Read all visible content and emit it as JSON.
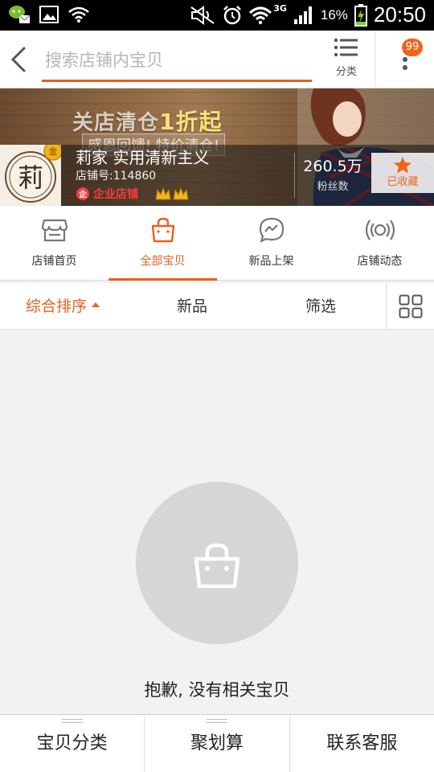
{
  "status_bar": {
    "battery": "16%",
    "network": "3G",
    "time": "20:50",
    "icons": [
      "wechat-notification-icon",
      "image-notification-icon",
      "wifi-alt-icon",
      "mute-icon",
      "alarm-icon",
      "wifi-icon",
      "signal-icon",
      "battery-charging-icon"
    ]
  },
  "header": {
    "search_placeholder": "搜索店铺内宝贝",
    "category_label": "分类",
    "badge_count": "99"
  },
  "banner": {
    "promo_pre": "关店清仓",
    "promo_hl": "1折起",
    "promo_post": "",
    "sub_text": "感恩回馈! 特价清仓!"
  },
  "shop": {
    "logo_char": "莉",
    "logo_badge": "金",
    "name": "莉家 实用清新主义",
    "id_text": "店铺号:114860",
    "type_label": "企业店铺",
    "fans_count": "260.5万",
    "fans_label": "粉丝数",
    "favorite_label": "已收藏"
  },
  "tabs": [
    {
      "label": "店铺首页",
      "icon": "store-icon",
      "active": false
    },
    {
      "label": "全部宝贝",
      "icon": "bag-icon",
      "active": true
    },
    {
      "label": "新品上架",
      "icon": "new-arrival-icon",
      "active": false
    },
    {
      "label": "店铺动态",
      "icon": "broadcast-icon",
      "active": false
    }
  ],
  "sort": {
    "composite": "综合排序",
    "new": "新品",
    "filter": "筛选"
  },
  "empty": {
    "message": "抱歉, 没有相关宝贝"
  },
  "bottom_bar": {
    "categories": "宝贝分类",
    "juhuasuan": "聚划算",
    "contact": "联系客服"
  },
  "colors": {
    "accent": "#e8601c",
    "badge": "#f2641e",
    "enterprise_red": "#ff3b3b",
    "empty_circle": "#d6d6d6"
  }
}
